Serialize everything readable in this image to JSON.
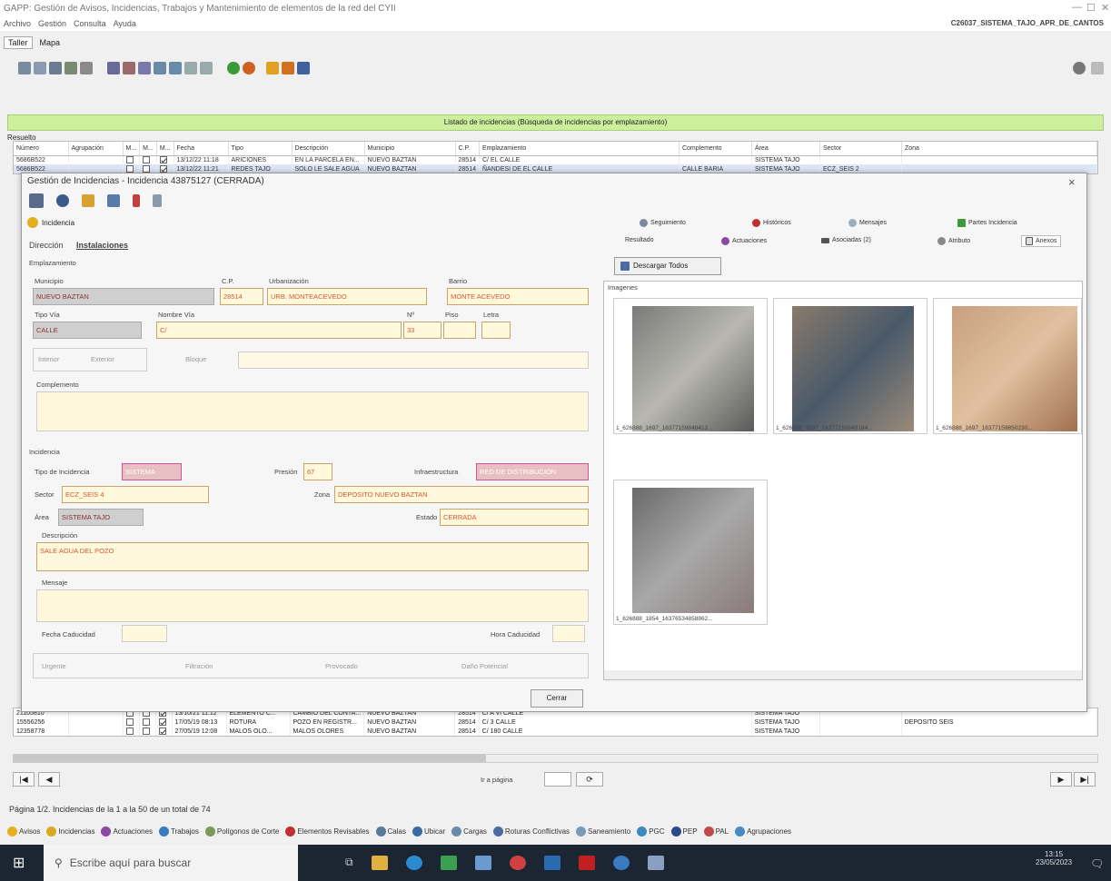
{
  "window": {
    "title": "GAPP: Gestión de Avisos, Incidencias, Trabajos y Mantenimiento de elementos de la red del CYII",
    "user": "C26037_SISTEMA_TAJO_APR_DE_CANTOS"
  },
  "menu": [
    "Archivo",
    "Gestión",
    "Consulta",
    "Ayuda"
  ],
  "tabs": {
    "taller": "Taller",
    "mapa": "Mapa"
  },
  "list_header": "Listado de incidencias (Búsqueda de incidencias por emplazamiento)",
  "resuelto": "Resuelto",
  "grid": {
    "columns": [
      "Número",
      "Agrupación",
      "M...",
      "M...",
      "M...",
      "Fecha",
      "Tipo",
      "Descripción",
      "Municipio",
      "C.P.",
      "Emplazamiento",
      "Complemento",
      "Área",
      "Sector",
      "Zona"
    ],
    "rows": [
      {
        "num": "5686B522",
        "fecha": "13/12/22 11:18",
        "tipo": "ARICIONES",
        "desc": "EN LA PARCELA EN...",
        "mun": "NUEVO BAZTAN",
        "cp": "28514",
        "emp": "C/ EL CALLE",
        "comp": "",
        "area": "SISTEMA TAJO",
        "sector": "",
        "zona": ""
      },
      {
        "num": "5686B522",
        "fecha": "13/12/22 11:21",
        "tipo": "REDES TAJO",
        "desc": "SOLO LE SALE AGUA",
        "mun": "NUEVO BAZTAN",
        "cp": "28514",
        "emp": "ÑANDESI DE EL CALLE",
        "comp": "CALLE BARIA",
        "area": "SISTEMA TAJO",
        "sector": "ECZ_SEIS 2",
        "zona": ""
      }
    ]
  },
  "lower_rows": [
    {
      "num": "21105810",
      "fecha": "13/10/21 11:12",
      "tipo": "ELEMENTO C...",
      "desc": "CAMBIO DEL CONTA...",
      "mun": "NUEVO BAZTAN",
      "cp": "28514",
      "emp": "C/ A VI CALLE",
      "area": "SISTEMA TAJO",
      "zona": ""
    },
    {
      "num": "15556256",
      "fecha": "17/05/19 08:13",
      "tipo": "ROTURA",
      "desc": "POZO EN REGISTR...",
      "mun": "NUEVO BAZTAN",
      "cp": "28514",
      "emp": "C/ 3 CALLE",
      "area": "SISTEMA TAJO",
      "zona": "DEPOSITO SEIS"
    },
    {
      "num": "12358778",
      "fecha": "27/05/19 12:08",
      "tipo": "MALOS OLO...",
      "desc": "MALOS OLORES",
      "mun": "NUEVO BAZTAN",
      "cp": "28514",
      "emp": "C/ 180 CALLE",
      "area": "SISTEMA TAJO",
      "zona": ""
    }
  ],
  "pager": {
    "ir_a": "Ir a página",
    "first": "|◀",
    "prev": "◀",
    "go": "⟳",
    "next": "▶",
    "last": "▶|"
  },
  "status": "Página 1/2. Incidencias de la 1 a la 50 de un total de 74",
  "bottom_nav": [
    "Avisos",
    "Incidencias",
    "Actuaciones",
    "Trabajos",
    "Polígonos de Corte",
    "Elementos Revisables",
    "Calas",
    "Ubicar",
    "Cargas",
    "Roturas Conflictivas",
    "Saneamiento",
    "PGC",
    "PEP",
    "PAL",
    "Agrupaciones"
  ],
  "dialog": {
    "title": "Gestión de Incidencias - Incidencia 43875127 (CERRADA)",
    "close": "×",
    "tag": "Incidencia",
    "subtabs": {
      "direccion": "Dirección",
      "instalaciones": "Instalaciones"
    },
    "emplazamiento": "Emplazamiento",
    "municipio_label": "Municipio",
    "municipio": "NUEVO BAZTAN",
    "cp_label": "C.P.",
    "cp": "28514",
    "urbanizacion_label": "Urbanización",
    "urbanizacion": "URB. MONTEACEVEDO",
    "barrio_label": "Barrio",
    "barrio": "MONTE ACEVEDO",
    "tipovia_label": "Tipo Vía",
    "tipovia": "CALLE",
    "nombrevia_label": "Nombre Vía",
    "nombrevia": "C/",
    "num_label": "Nº",
    "num": "33",
    "piso_label": "Piso",
    "letra_label": "Letra",
    "interior": "Interior",
    "exterior": "Exterior",
    "bloque": "Bloque",
    "complemento": "Complemento",
    "incidencia_section": "Incidencia",
    "tipo_label": "Tipo de Incidencia",
    "tipo": "SISTEMA",
    "presion_label": "Presión",
    "presion": "67",
    "infra_label": "Infraestructura",
    "infra": "RED DE DISTRIBUCIÓN",
    "sector_label": "Sector",
    "sector": "ECZ_SEIS 4",
    "zona_label": "Zona",
    "zona": "DEPOSITO NUEVO BAZTAN",
    "area_label": "Área",
    "area": "SISTEMA TAJO",
    "estado_label": "Estado",
    "estado": "CERRADA",
    "descripcion_label": "Descripción",
    "descripcion": "SALE AGUA DEL POZO",
    "mensaje_label": "Mensaje",
    "fecha_cad": "Fecha Caducidad",
    "hora_cad": "Hora Caducidad",
    "flags": [
      "Urgente",
      "Filtración",
      "Provocado",
      "Daño Potencial"
    ],
    "cerrar": "Cerrar",
    "right_tabs_row1": [
      "Seguimiento",
      "Históricos",
      "Mensajes",
      "Partes Incidencia"
    ],
    "right_tabs_row2": [
      "Resultado",
      "Actuaciones",
      "Asociadas (2)",
      "Atributo",
      "Anexos"
    ],
    "descargar": "Descargar Todos",
    "imagenes": "Imagenes",
    "thumbs": [
      "1_626888_1697_16377159848412...",
      "1_626888_1697_16377159848184...",
      "1_626888_1697_16377159850230...",
      "1_626888_1854_16376534858862..."
    ]
  },
  "taskbar": {
    "search": "Escribe aquí para buscar",
    "time": "13:15",
    "date": "23/05/2023"
  }
}
